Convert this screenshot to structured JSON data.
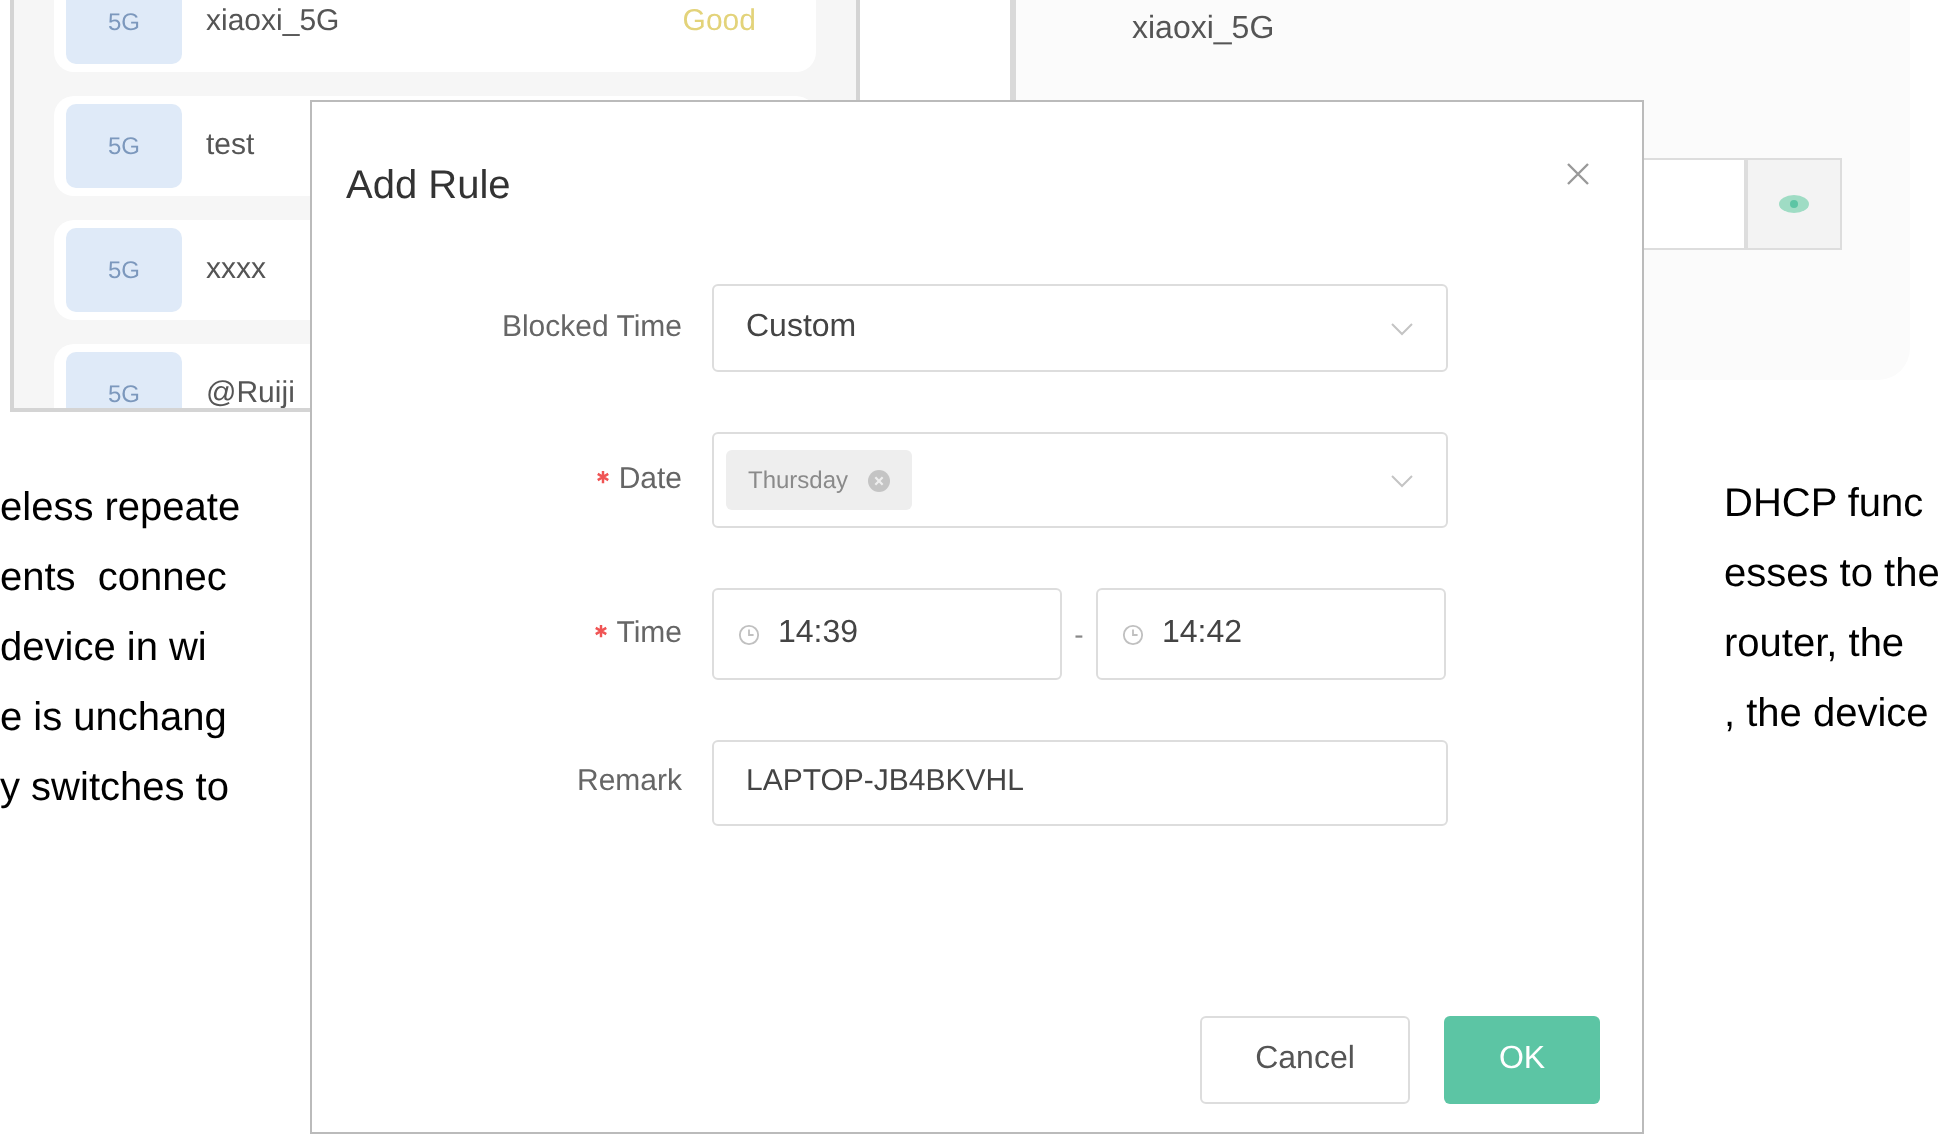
{
  "background": {
    "networks": [
      {
        "band": "5G",
        "name": "xiaoxi_5G",
        "signal": "Good"
      },
      {
        "band": "5G",
        "name": "test"
      },
      {
        "band": "5G",
        "name": "xxxx"
      },
      {
        "band": "5G",
        "name": "@Ruiji"
      }
    ],
    "detail": {
      "ssid": "xiaoxi_5G"
    },
    "document_text": {
      "left": [
        "eless repeate",
        "ents  connec",
        "device in wi",
        "e is unchang",
        "y switches to"
      ],
      "right": [
        "DHCP func",
        "esses to the",
        "router, the",
        ", the device"
      ]
    }
  },
  "dialog": {
    "title": "Add Rule",
    "fields": [
      {
        "kind": "select",
        "label": "Blocked Time",
        "required": false,
        "value": "Custom"
      },
      {
        "kind": "tags",
        "label": "Date",
        "required": true,
        "tags": [
          "Thursday"
        ]
      },
      {
        "kind": "time_range",
        "label": "Time",
        "required": true,
        "start": "14:39",
        "separator": "-",
        "end": "14:42"
      },
      {
        "kind": "text",
        "label": "Remark",
        "required": false,
        "value": "LAPTOP-JB4BKVHL"
      }
    ],
    "buttons": [
      {
        "label": "Cancel",
        "kind": "secondary"
      },
      {
        "label": "OK",
        "kind": "primary"
      }
    ]
  }
}
